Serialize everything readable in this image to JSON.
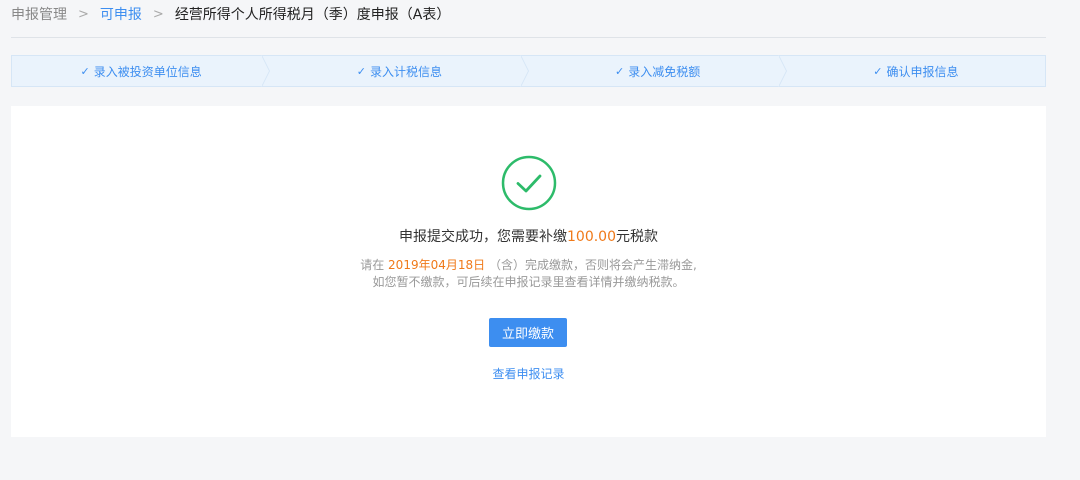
{
  "breadcrumb": {
    "item1": "申报管理",
    "item2": "可申报",
    "current": "经营所得个人所得税月（季）度申报（A表）",
    "separator": ">"
  },
  "steps": [
    {
      "label": "录入被投资单位信息",
      "icon": "check-icon"
    },
    {
      "label": "录入计税信息",
      "icon": "check-icon"
    },
    {
      "label": "录入减免税额",
      "icon": "check-icon"
    },
    {
      "label": "确认申报信息",
      "icon": "check-icon"
    }
  ],
  "result": {
    "icon": "success-check-icon",
    "title_prefix": "申报提交成功，您需要补缴",
    "amount": "100.00",
    "title_suffix": "元税款",
    "desc_prefix": "请在 ",
    "deadline": "2019年04月18日",
    "desc_suffix": " （含）完成缴款，否则将会产生滞纳金,",
    "desc_line2": "如您暂不缴款，可后续在申报记录里查看详情并缴纳税款。"
  },
  "actions": {
    "pay_now": "立即缴款",
    "view_records": "查看申报记录"
  },
  "colors": {
    "primary": "#3d8ef0",
    "success": "#2dbb6a",
    "highlight": "#f07a1a",
    "step_bg": "#eaf3fc"
  }
}
